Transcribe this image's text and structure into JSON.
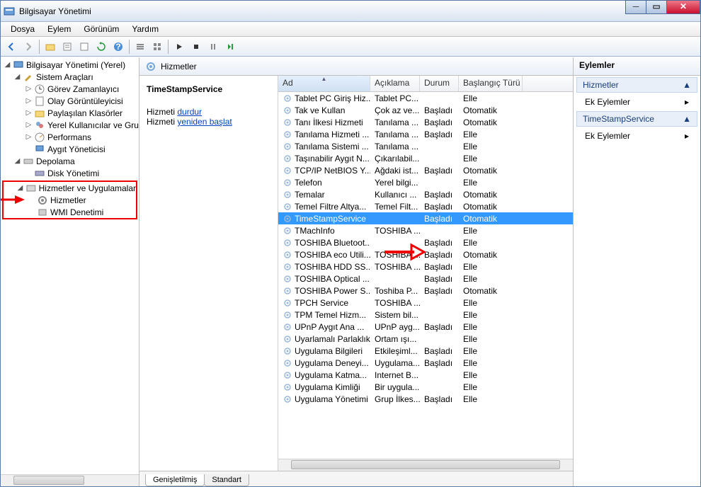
{
  "window": {
    "title": "Bilgisayar Yönetimi"
  },
  "menu": {
    "file": "Dosya",
    "action": "Eylem",
    "view": "Görünüm",
    "help": "Yardım"
  },
  "tree": {
    "root": "Bilgisayar Yönetimi (Yerel)",
    "sys_tools": "Sistem Araçları",
    "task_sched": "Görev Zamanlayıcı",
    "event_viewer": "Olay Görüntüleyicisi",
    "shared": "Paylaşılan Klasörler",
    "local_users": "Yerel Kullanıcılar ve Gru",
    "perf": "Performans",
    "dev_mgr": "Aygıt Yöneticisi",
    "storage": "Depolama",
    "disk_mgmt": "Disk Yönetimi",
    "svc_apps": "Hizmetler ve Uygulamalar",
    "services": "Hizmetler",
    "wmi": "WMI Denetimi"
  },
  "center": {
    "header": "Hizmetler",
    "selected_name": "TimeStampService",
    "stop_prefix": "Hizmeti ",
    "stop_link": "durdur",
    "restart_prefix": "Hizmeti ",
    "restart_link": "yeniden başlat"
  },
  "columns": {
    "name": "Ad",
    "desc": "Açıklama",
    "status": "Durum",
    "startup": "Başlangıç Türü"
  },
  "tabs": {
    "extended": "Genişletilmiş",
    "standard": "Standart"
  },
  "actions": {
    "pane_title": "Eylemler",
    "section1": "Hizmetler",
    "more1": "Ek Eylemler",
    "section2": "TimeStampService",
    "more2": "Ek Eylemler"
  },
  "services": [
    {
      "name": "Tablet PC Giriş Hiz...",
      "desc": "Tablet PC...",
      "status": "",
      "startup": "Elle"
    },
    {
      "name": "Tak ve Kullan",
      "desc": "Çok az ve...",
      "status": "Başladı",
      "startup": "Otomatik"
    },
    {
      "name": "Tanı İlkesi Hizmeti",
      "desc": "Tanılama ...",
      "status": "Başladı",
      "startup": "Otomatik"
    },
    {
      "name": "Tanılama Hizmeti ...",
      "desc": "Tanılama ...",
      "status": "Başladı",
      "startup": "Elle"
    },
    {
      "name": "Tanılama Sistemi ...",
      "desc": "Tanılama ...",
      "status": "",
      "startup": "Elle"
    },
    {
      "name": "Taşınabilir Aygıt N...",
      "desc": "Çıkarılabil...",
      "status": "",
      "startup": "Elle"
    },
    {
      "name": "TCP/IP NetBIOS Y...",
      "desc": "Ağdaki ist...",
      "status": "Başladı",
      "startup": "Otomatik"
    },
    {
      "name": "Telefon",
      "desc": "Yerel bilgi...",
      "status": "",
      "startup": "Elle"
    },
    {
      "name": "Temalar",
      "desc": "Kullanıcı ...",
      "status": "Başladı",
      "startup": "Otomatik"
    },
    {
      "name": "Temel Filtre Altya...",
      "desc": "Temel Filt...",
      "status": "Başladı",
      "startup": "Otomatik"
    },
    {
      "name": "TimeStampService",
      "desc": "",
      "status": "Başladı",
      "startup": "Otomatik"
    },
    {
      "name": "TMachInfo",
      "desc": "TOSHIBA ...",
      "status": "",
      "startup": "Elle"
    },
    {
      "name": "TOSHIBA Bluetoot...",
      "desc": "",
      "status": "Başladı",
      "startup": "Elle"
    },
    {
      "name": "TOSHIBA eco Utili...",
      "desc": "TOSHIBA ...",
      "status": "Başladı",
      "startup": "Otomatik"
    },
    {
      "name": "TOSHIBA HDD SS...",
      "desc": "TOSHIBA ...",
      "status": "Başladı",
      "startup": "Elle"
    },
    {
      "name": "TOSHIBA Optical ...",
      "desc": "",
      "status": "Başladı",
      "startup": "Elle"
    },
    {
      "name": "TOSHIBA Power S...",
      "desc": "Toshiba P...",
      "status": "Başladı",
      "startup": "Otomatik"
    },
    {
      "name": "TPCH Service",
      "desc": "TOSHIBA ...",
      "status": "",
      "startup": "Elle"
    },
    {
      "name": "TPM Temel Hizm...",
      "desc": "Sistem bil...",
      "status": "",
      "startup": "Elle"
    },
    {
      "name": "UPnP Aygıt Ana ...",
      "desc": "UPnP ayg...",
      "status": "Başladı",
      "startup": "Elle"
    },
    {
      "name": "Uyarlamalı Parlaklık",
      "desc": "Ortam ışı...",
      "status": "",
      "startup": "Elle"
    },
    {
      "name": "Uygulama Bilgileri",
      "desc": "Etkileşiml...",
      "status": "Başladı",
      "startup": "Elle"
    },
    {
      "name": "Uygulama Deneyi...",
      "desc": "Uygulama...",
      "status": "Başladı",
      "startup": "Elle"
    },
    {
      "name": "Uygulama Katma...",
      "desc": "Internet B...",
      "status": "",
      "startup": "Elle"
    },
    {
      "name": "Uygulama Kimliği",
      "desc": "Bir uygula...",
      "status": "",
      "startup": "Elle"
    },
    {
      "name": "Uygulama Yönetimi",
      "desc": "Grup İlkes...",
      "status": "Başladı",
      "startup": "Elle"
    }
  ],
  "selected_index": 10
}
